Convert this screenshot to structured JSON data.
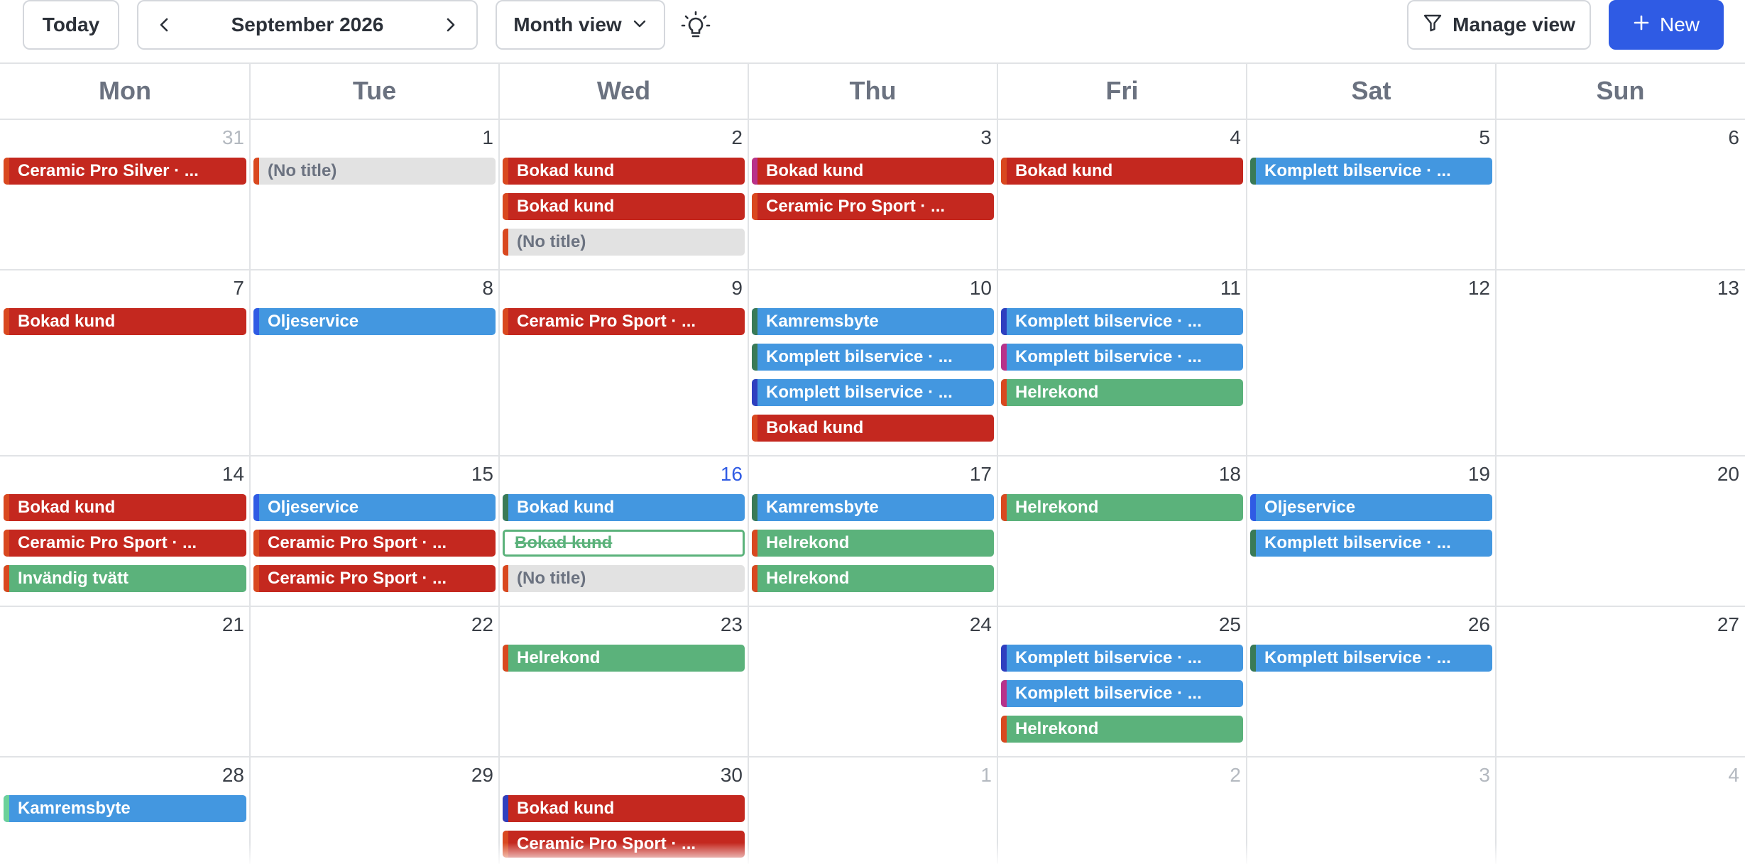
{
  "toolbar": {
    "today_label": "Today",
    "month_label": "September 2026",
    "view_label": "Month view",
    "manage_label": "Manage view",
    "new_label": "New"
  },
  "colors": {
    "accent": "#2f5be4",
    "event_red": "#c4281f",
    "event_blue": "#4397e0",
    "event_green": "#5bb27b",
    "event_gray": "#e2e2e2",
    "strip_colors": [
      "#d9481f",
      "#2f5be4",
      "#3a7a56",
      "#b8328a",
      "#e3452e",
      "#6bd19a"
    ]
  },
  "weekdays": [
    "Mon",
    "Tue",
    "Wed",
    "Thu",
    "Fri",
    "Sat",
    "Sun"
  ],
  "weeks": [
    {
      "days": [
        {
          "num": "31",
          "status": "outside",
          "events": [
            {
              "title": "Ceramic Pro Silver · ...",
              "color": "red",
              "strip": "#d9481f"
            }
          ]
        },
        {
          "num": "1",
          "events": [
            {
              "title": "(No title)",
              "color": "gray",
              "strip": "#d9481f"
            }
          ]
        },
        {
          "num": "2",
          "events": [
            {
              "title": "Bokad kund",
              "color": "red",
              "strip": "#d9481f"
            },
            {
              "title": "Bokad kund",
              "color": "red",
              "strip": "#d9481f"
            },
            {
              "title": "(No title)",
              "color": "gray",
              "strip": "#d9481f"
            }
          ]
        },
        {
          "num": "3",
          "events": [
            {
              "title": "Bokad kund",
              "color": "red",
              "strip": "#b8328a"
            },
            {
              "title": "Ceramic Pro Sport · ...",
              "color": "red",
              "strip": "#d9481f"
            }
          ]
        },
        {
          "num": "4",
          "events": [
            {
              "title": "Bokad kund",
              "color": "red",
              "strip": "#d9481f"
            }
          ]
        },
        {
          "num": "5",
          "events": [
            {
              "title": "Komplett bilservice · ...",
              "color": "blue",
              "strip": "#3a7a56"
            }
          ]
        },
        {
          "num": "6",
          "events": []
        }
      ]
    },
    {
      "days": [
        {
          "num": "7",
          "events": [
            {
              "title": "Bokad kund",
              "color": "red",
              "strip": "#d9481f"
            }
          ]
        },
        {
          "num": "8",
          "events": [
            {
              "title": "Oljeservice",
              "color": "blue",
              "strip": "#2f5be4"
            }
          ]
        },
        {
          "num": "9",
          "events": [
            {
              "title": "Ceramic Pro Sport · ...",
              "color": "red",
              "strip": "#d9481f"
            }
          ]
        },
        {
          "num": "10",
          "events": [
            {
              "title": "Kamremsbyte",
              "color": "blue",
              "strip": "#3a7a56"
            },
            {
              "title": "Komplett bilservice · ...",
              "color": "blue",
              "strip": "#3a7a56"
            },
            {
              "title": "Komplett bilservice · ...",
              "color": "blue",
              "strip": "#2f3fbf"
            },
            {
              "title": "Bokad kund",
              "color": "red",
              "strip": "#d9481f"
            }
          ]
        },
        {
          "num": "11",
          "events": [
            {
              "title": "Komplett bilservice · ...",
              "color": "blue",
              "strip": "#2f3fbf"
            },
            {
              "title": "Komplett bilservice · ...",
              "color": "blue",
              "strip": "#b8328a"
            },
            {
              "title": "Helrekond",
              "color": "green",
              "strip": "#d9481f"
            }
          ]
        },
        {
          "num": "12",
          "events": []
        },
        {
          "num": "13",
          "events": []
        }
      ]
    },
    {
      "days": [
        {
          "num": "14",
          "events": [
            {
              "title": "Bokad kund",
              "color": "red",
              "strip": "#d9481f"
            },
            {
              "title": "Ceramic Pro Sport · ...",
              "color": "red",
              "strip": "#d9481f"
            },
            {
              "title": "Invändig tvätt",
              "color": "green",
              "strip": "#d9481f"
            }
          ]
        },
        {
          "num": "15",
          "events": [
            {
              "title": "Oljeservice",
              "color": "blue",
              "strip": "#2f5be4"
            },
            {
              "title": "Ceramic Pro Sport · ...",
              "color": "red",
              "strip": "#d9481f"
            },
            {
              "title": "Ceramic Pro Sport · ...",
              "color": "red",
              "strip": "#d9481f"
            }
          ]
        },
        {
          "num": "16",
          "status": "today",
          "events": [
            {
              "title": "Bokad kund",
              "color": "blue",
              "strip": "#3a7a56"
            },
            {
              "title": "Bokad kund",
              "color": "outline",
              "strip": "#d9481f"
            },
            {
              "title": "(No title)",
              "color": "gray",
              "strip": "#d9481f"
            }
          ]
        },
        {
          "num": "17",
          "events": [
            {
              "title": "Kamremsbyte",
              "color": "blue",
              "strip": "#3a7a56"
            },
            {
              "title": "Helrekond",
              "color": "green",
              "strip": "#d9481f"
            },
            {
              "title": "Helrekond",
              "color": "green",
              "strip": "#d9481f"
            }
          ]
        },
        {
          "num": "18",
          "events": [
            {
              "title": "Helrekond",
              "color": "green",
              "strip": "#d9481f"
            }
          ]
        },
        {
          "num": "19",
          "events": [
            {
              "title": "Oljeservice",
              "color": "blue",
              "strip": "#2f5be4"
            },
            {
              "title": "Komplett bilservice · ...",
              "color": "blue",
              "strip": "#3a7a56"
            }
          ]
        },
        {
          "num": "20",
          "events": []
        }
      ]
    },
    {
      "days": [
        {
          "num": "21",
          "events": []
        },
        {
          "num": "22",
          "events": []
        },
        {
          "num": "23",
          "events": [
            {
              "title": "Helrekond",
              "color": "green",
              "strip": "#d9481f"
            }
          ]
        },
        {
          "num": "24",
          "events": []
        },
        {
          "num": "25",
          "events": [
            {
              "title": "Komplett bilservice · ...",
              "color": "blue",
              "strip": "#2f3fbf"
            },
            {
              "title": "Komplett bilservice · ...",
              "color": "blue",
              "strip": "#b8328a"
            },
            {
              "title": "Helrekond",
              "color": "green",
              "strip": "#d9481f"
            }
          ]
        },
        {
          "num": "26",
          "events": [
            {
              "title": "Komplett bilservice · ...",
              "color": "blue",
              "strip": "#3a7a56"
            }
          ]
        },
        {
          "num": "27",
          "events": []
        }
      ]
    },
    {
      "days": [
        {
          "num": "28",
          "events": [
            {
              "title": "Kamremsbyte",
              "color": "blue",
              "strip": "#6bd19a"
            }
          ]
        },
        {
          "num": "29",
          "events": []
        },
        {
          "num": "30",
          "events": [
            {
              "title": "Bokad kund",
              "color": "red",
              "strip": "#2f3fbf"
            },
            {
              "title": "Ceramic Pro Sport · ...",
              "color": "red",
              "strip": "#d9481f"
            }
          ]
        },
        {
          "num": "1",
          "status": "outside",
          "events": []
        },
        {
          "num": "2",
          "status": "outside",
          "events": []
        },
        {
          "num": "3",
          "status": "outside",
          "events": []
        },
        {
          "num": "4",
          "status": "outside",
          "events": []
        }
      ]
    }
  ]
}
